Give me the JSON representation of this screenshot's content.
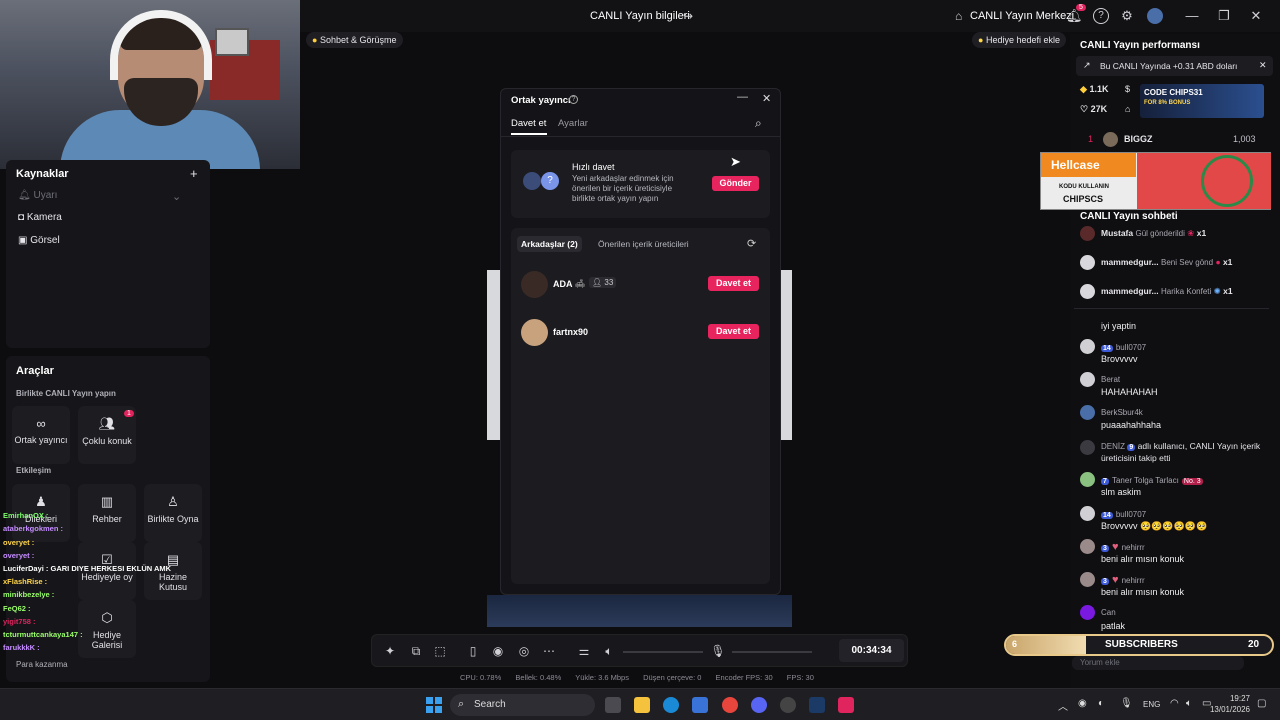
{
  "topbar": {
    "title": "CANLI Yayın bilgileri",
    "center_label": "CANLI Yayın Merkezi",
    "notif_count": "5"
  },
  "window_controls": {
    "minimize": "—",
    "maximize": "❐",
    "close": "✕"
  },
  "tags": {
    "left_tag": "Sohbet & Görüşme",
    "right_tag": "Hediye hedefi ekle"
  },
  "sources": {
    "title": "Kaynaklar",
    "add": "+",
    "items": [
      {
        "label": "Uyarı",
        "disabled": true
      },
      {
        "label": "Kamera",
        "disabled": false
      },
      {
        "label": "Görsel",
        "disabled": false
      }
    ]
  },
  "tools": {
    "title": "Araçlar",
    "section1": "Birlikte CANLI Yayın yapın",
    "cohost_label": "Ortak yayıncı",
    "multiguest_label": "Çoklu konuk",
    "multiguest_badge": "1",
    "section2": "Etkileşim",
    "interaction": [
      {
        "label": "Dilekleri"
      },
      {
        "label": "Rehber"
      },
      {
        "label": "Birlikte Oyna"
      },
      {
        "label": "Hediyeyle oy"
      },
      {
        "label": "Hazine Kutusu"
      },
      {
        "label": "Hediye Galerisi"
      }
    ],
    "earn": "Para kazanma"
  },
  "overlay_chat": [
    {
      "user": "EmirhanOX :",
      "color": "#7dff6a"
    },
    {
      "user": "ataberkgokmen :",
      "color": "#c58cff"
    },
    {
      "user": "overyet :",
      "color": "#ffd54a"
    },
    {
      "user": "overyet :",
      "color": "#c58cff"
    },
    {
      "user": "LuciferDayi : GARI DIYE HERKESI EKLÜN AMK",
      "color": "#ffffff"
    },
    {
      "user": "xFlashRise :",
      "color": "#ffd54a"
    },
    {
      "user": "minikbezelye :",
      "color": "#9aff6a"
    },
    {
      "user": "FeQ62 :",
      "color": "#9aff6a"
    },
    {
      "user": "yigit758 :",
      "color": "#e0245e"
    },
    {
      "user": "tcturmuttcankaya147 :",
      "color": "#9aff6a"
    },
    {
      "user": "farukkkK :",
      "color": "#c58cff"
    }
  ],
  "dialog": {
    "title": "Ortak yayıncı",
    "tabs": [
      "Davet et",
      "Ayarlar"
    ],
    "quick_invite_title": "Hızlı davet",
    "quick_invite_desc": "Yeni arkadaşlar edinmek için önerilen bir içerik üreticisiyle birlikte ortak yayın yapın",
    "send_label": "Gönder",
    "list_tabs": [
      "Arkadaşlar (2)",
      "Önerilen içerik üreticileri"
    ],
    "friends": [
      {
        "name": "ADA",
        "followers": "33",
        "action": "Davet et"
      },
      {
        "name": "fartnx90",
        "action": "Davet et"
      }
    ]
  },
  "controls": {
    "timer": "00:34:34"
  },
  "stats": {
    "cpu": "CPU: 0.78%",
    "memory": "Bellek: 0.48%",
    "upload": "Yükle: 3.6 Mbps",
    "dropped": "Düşen çerçeve: 0",
    "encoder_fps": "Encoder FPS: 30",
    "fps": "FPS: 30"
  },
  "performance": {
    "title": "CANLI Yayın performansı",
    "earning_text": "Bu CANLI Yayında +0.31 ABD doları",
    "diamonds": "1.1K",
    "likes": "27K",
    "top_rank": "1",
    "top_user": "BIGGZ",
    "top_score": "1,003"
  },
  "ads": {
    "code_label": "CODE CHIPS31",
    "code_sub": "FOR 8% BONUS",
    "hellcase": "Hellcase",
    "hellcase_code_label": "KODU KULLANIN",
    "hellcase_code": "CHIPSCS"
  },
  "chat": {
    "title": "CANLI Yayın sohbeti",
    "gifts": [
      {
        "user": "Mustafa",
        "text": "Gül gönderildi",
        "count": "x1"
      },
      {
        "user": "mammedgur...",
        "text": "Beni Sev gönd",
        "count": "x1"
      },
      {
        "user": "mammedgur...",
        "text": "Harika Konfeti",
        "count": "x1"
      }
    ],
    "messages": [
      {
        "name": "",
        "msg": "iyi yaptin"
      },
      {
        "name": "bull0707",
        "level": "14",
        "msg": "Brovvvvv"
      },
      {
        "name": "Berat",
        "msg": "HAHAHAHAH"
      },
      {
        "name": "BerkSbur4k",
        "msg": "puaaahahhaha"
      },
      {
        "name": "DENİZ",
        "level": "9",
        "msg": "adlı kullanıcı, CANLI Yayın içerik üreticisini takip etti"
      },
      {
        "name": "Taner Tolga Tarlacı",
        "level": "7",
        "rank": "No. 3",
        "msg": "slm askim"
      },
      {
        "name": "bull0707",
        "level": "14",
        "msg": "Brovvvvv 🥺🥺🥺🥺🥺🥺"
      },
      {
        "name": "nehirrr",
        "level": "3",
        "msg": "beni alır mısın konuk"
      },
      {
        "name": "nehirrr",
        "level": "3",
        "msg": "beni alır mısın konuk"
      },
      {
        "name": "Can",
        "msg": "patlak"
      }
    ],
    "comment_placeholder": "Yorum ekle"
  },
  "subscribers": {
    "left": "6",
    "label": "SUBSCRIBERS",
    "right": "20"
  },
  "taskbar": {
    "search": "Search",
    "lang": "ENG",
    "time": "19:27",
    "date": "13/01/2026"
  }
}
